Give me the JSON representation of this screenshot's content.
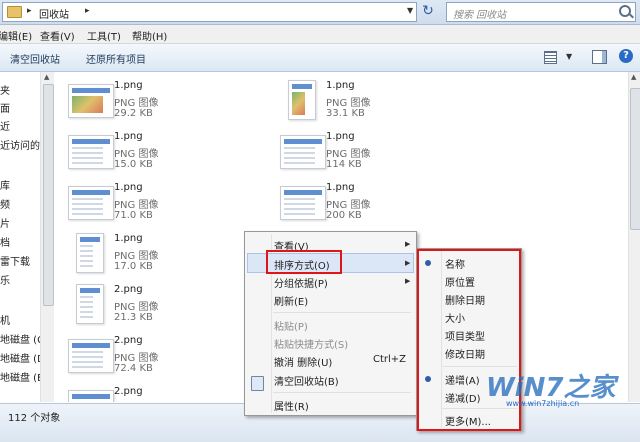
{
  "address": {
    "path": "回收站",
    "search_placeholder": "搜索 回收站"
  },
  "menubar": [
    "编辑(E)",
    "查看(V)",
    "工具(T)",
    "帮助(H)"
  ],
  "toolbar": {
    "empty_label": "清空回收站",
    "restore_label": "还原所有项目"
  },
  "nav": {
    "items": [
      "夹",
      "面",
      "近",
      "近访问的位",
      "库",
      "频",
      "片",
      "档",
      "雷下载",
      "乐",
      "机",
      "地磁盘 (C:",
      "地磁盘 (D",
      "地磁盘 (E:"
    ]
  },
  "files": [
    {
      "name": "1.png",
      "type": "PNG 图像",
      "size": "29.2 KB"
    },
    {
      "name": "1.png",
      "type": "PNG 图像",
      "size": "33.1 KB"
    },
    {
      "name": "1.png",
      "type": "PNG 图像",
      "size": "15.0 KB"
    },
    {
      "name": "1.png",
      "type": "PNG 图像",
      "size": "114 KB"
    },
    {
      "name": "1.png",
      "type": "PNG 图像",
      "size": "71.0 KB"
    },
    {
      "name": "1.png",
      "type": "PNG 图像",
      "size": "200 KB"
    },
    {
      "name": "1.png",
      "type": "PNG 图像",
      "size": "17.0 KB"
    },
    {
      "name": "2.png",
      "type": "PNG 图像",
      "size": "21.3 KB"
    },
    {
      "name": "2.png",
      "type": "PNG 图像",
      "size": "72.4 KB"
    },
    {
      "name": "2.png",
      "type": "",
      "size": ""
    }
  ],
  "status": {
    "count": "112 个对象"
  },
  "context_menu": {
    "view": "查看(V)",
    "sort": "排序方式(O)",
    "group": "分组依据(P)",
    "refresh": "刷新(E)",
    "paste": "粘贴(P)",
    "paste_shortcut": "粘贴快捷方式(S)",
    "undo": "撤消 删除(U)",
    "undo_shortcut": "Ctrl+Z",
    "empty": "清空回收站(B)",
    "properties": "属性(R)"
  },
  "submenu": {
    "items": [
      "名称",
      "原位置",
      "删除日期",
      "大小",
      "项目类型",
      "修改日期"
    ],
    "ascending": "递增(A)",
    "descending": "递减(D)",
    "more": "更多(M)..."
  },
  "watermark": {
    "brand": "WiN7之家",
    "url": "www.win7zhijia.cn"
  },
  "colors": {
    "highlight_box": "#e01515",
    "watermark": "#2a6bc7"
  }
}
